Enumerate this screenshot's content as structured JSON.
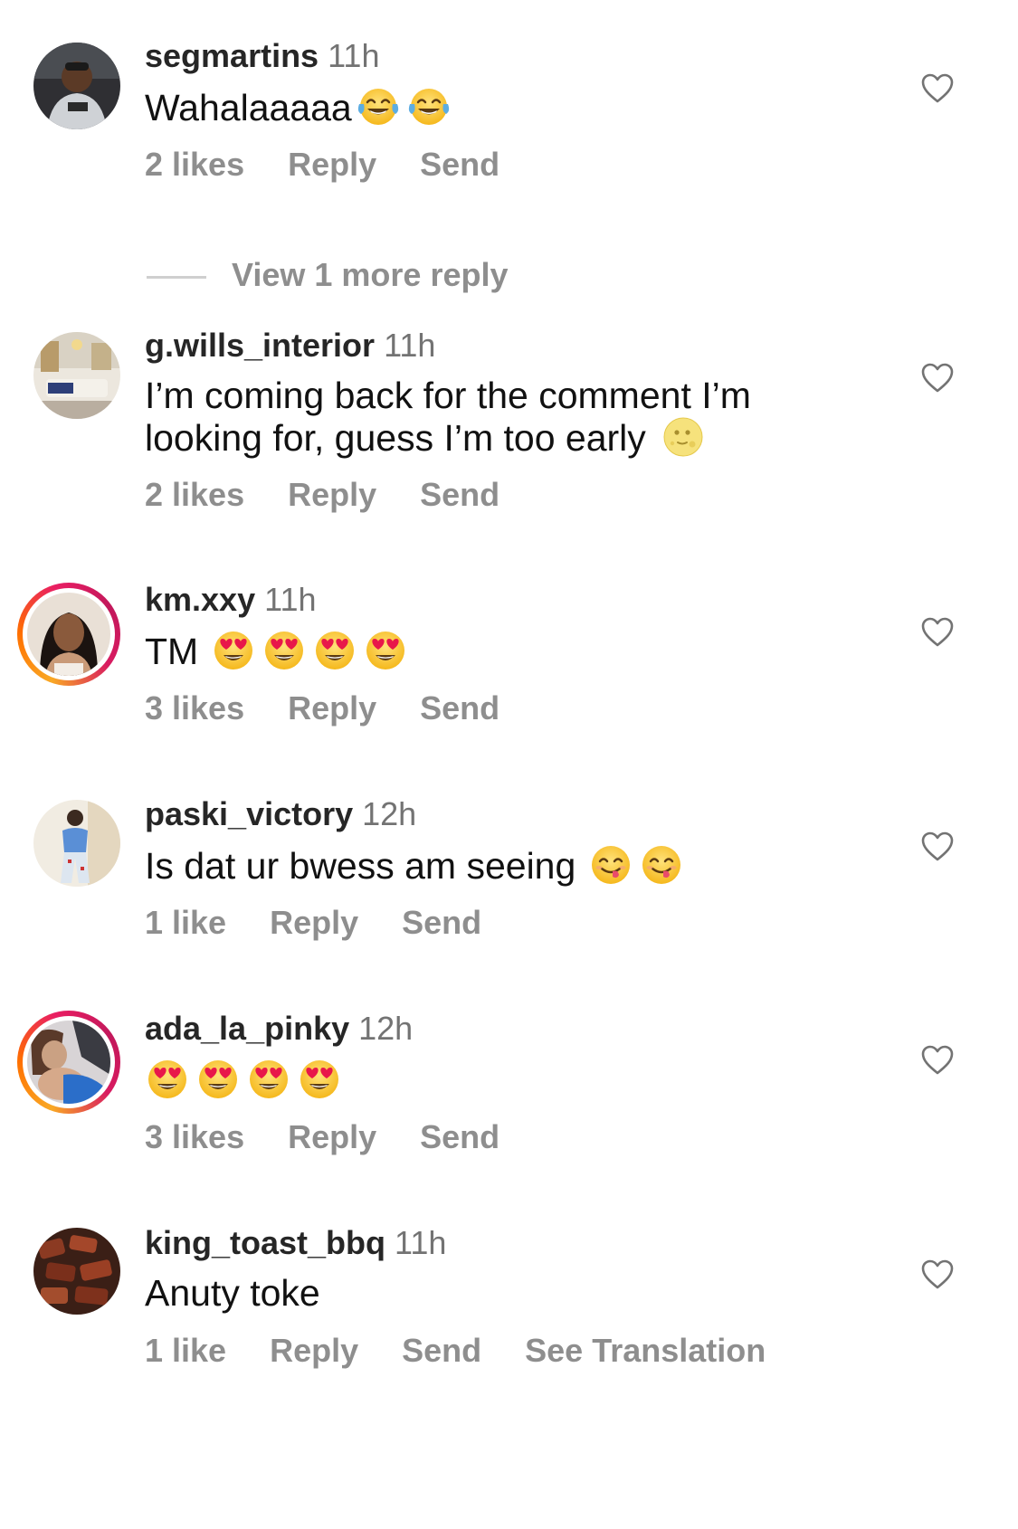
{
  "comments": [
    {
      "username": "segmartins",
      "time": "11h",
      "text": "Wahalaaaaa",
      "emojis": [
        "face-with-tears-of-joy",
        "face-with-tears-of-joy"
      ],
      "likes": "2 likes",
      "reply": "Reply",
      "send": "Send",
      "view_more": "View 1 more reply"
    },
    {
      "username": "g.wills_interior",
      "time": "11h",
      "text_line1": "I’m coming back for the comment I’m",
      "text_line2": "looking for, guess I’m too early",
      "emojis": [
        "full-moon-face"
      ],
      "likes": "2 likes",
      "reply": "Reply",
      "send": "Send"
    },
    {
      "username": "km.xxy",
      "time": "11h",
      "text": "TM",
      "emojis": [
        "heart-eyes",
        "heart-eyes",
        "heart-eyes",
        "heart-eyes"
      ],
      "likes": "3 likes",
      "reply": "Reply",
      "send": "Send"
    },
    {
      "username": "paski_victory",
      "time": "12h",
      "text": "Is dat ur bwess am seeing",
      "emojis": [
        "face-savoring-food",
        "face-savoring-food"
      ],
      "likes": "1 like",
      "reply": "Reply",
      "send": "Send"
    },
    {
      "username": "ada_la_pinky",
      "time": "12h",
      "text": "",
      "emojis": [
        "heart-eyes",
        "heart-eyes",
        "heart-eyes",
        "heart-eyes"
      ],
      "likes": "3 likes",
      "reply": "Reply",
      "send": "Send"
    },
    {
      "username": "king_toast_bbq",
      "time": "11h",
      "text": "Anuty toke",
      "likes": "1 like",
      "reply": "Reply",
      "send": "Send",
      "see_translation": "See Translation"
    }
  ],
  "colors": {
    "username": "#262626",
    "meta": "#8e8e8e",
    "story_ring": "#e91e63"
  }
}
